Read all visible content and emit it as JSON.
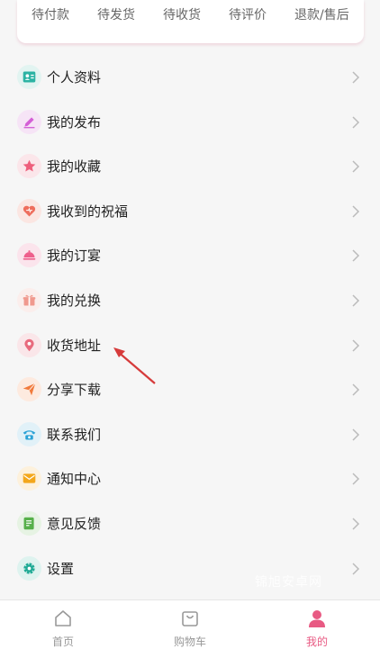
{
  "order_tabs": [
    {
      "label": "待付款"
    },
    {
      "label": "待发货"
    },
    {
      "label": "待收货"
    },
    {
      "label": "待评价"
    },
    {
      "label": "退款/售后"
    }
  ],
  "menu": [
    {
      "label": "个人资料",
      "icon": "profile-card-icon",
      "color": "#2bb3a3",
      "bg": "#e2f4f1"
    },
    {
      "label": "我的发布",
      "icon": "pencil-icon",
      "color": "#d45fd6",
      "bg": "#f6e4f6"
    },
    {
      "label": "我的收藏",
      "icon": "star-icon",
      "color": "#ee5f7c",
      "bg": "#fbe6ea"
    },
    {
      "label": "我收到的祝福",
      "icon": "heart-icon",
      "color": "#ee6e5d",
      "bg": "#fbe6e2"
    },
    {
      "label": "我的订宴",
      "icon": "dish-cover-icon",
      "color": "#ee5f8c",
      "bg": "#fbe4ec"
    },
    {
      "label": "我的兑换",
      "icon": "gift-icon",
      "color": "#f0998e",
      "bg": "#fbeeec"
    },
    {
      "label": "收货地址",
      "icon": "location-pin-icon",
      "color": "#e86a7d",
      "bg": "#fae6e9"
    },
    {
      "label": "分享下载",
      "icon": "paper-plane-icon",
      "color": "#f17b3d",
      "bg": "#fdeadf"
    },
    {
      "label": "联系我们",
      "icon": "phone-icon",
      "color": "#2aa2d6",
      "bg": "#e1f1f8"
    },
    {
      "label": "通知中心",
      "icon": "envelope-icon",
      "color": "#f3a71b",
      "bg": "#fdf1dc"
    },
    {
      "label": "意见反馈",
      "icon": "feedback-icon",
      "color": "#56b04a",
      "bg": "#e6f3e3"
    },
    {
      "label": "设置",
      "icon": "gear-icon",
      "color": "#1faa95",
      "bg": "#def3ef"
    }
  ],
  "watermark": "锦旭安卓网",
  "tabbar": [
    {
      "label": "首页",
      "icon": "home-icon"
    },
    {
      "label": "购物车",
      "icon": "shopping-bag-icon"
    },
    {
      "label": "我的",
      "icon": "user-icon"
    }
  ],
  "colors": {
    "accent": "#e85a83",
    "annotation": "#d63b3b"
  }
}
